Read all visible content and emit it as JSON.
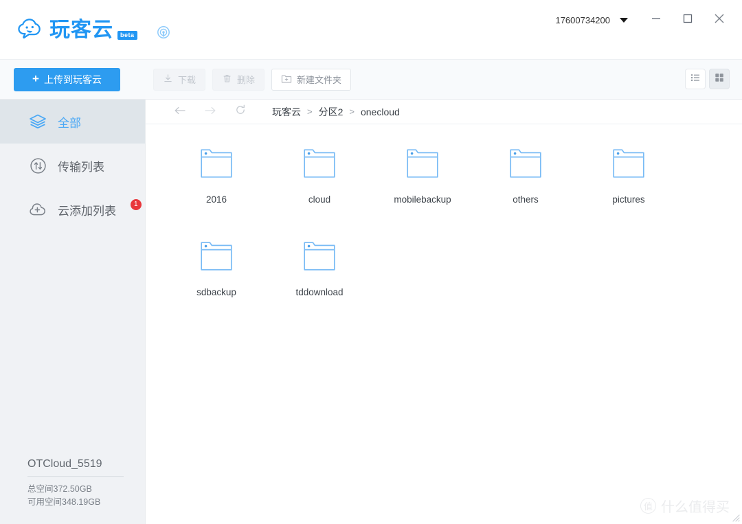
{
  "app": {
    "brand_name": "玩客云",
    "brand_tag": "beta",
    "logo_icon": "cloud-mascot-logo",
    "help_icon": "connection-signal-icon"
  },
  "titlebar": {
    "account_id": "17600734200",
    "account_caret_icon": "chevron-down-icon",
    "minimize_icon": "minimize-icon",
    "maximize_icon": "maximize-icon",
    "close_icon": "close-icon"
  },
  "toolbar": {
    "upload_label": "上传到玩客云",
    "upload_plus": "+",
    "download_label": "下载",
    "download_icon": "download-icon",
    "delete_label": "删除",
    "delete_icon": "trash-icon",
    "newfolder_label": "新建文件夹",
    "newfolder_icon": "folder-plus-icon",
    "list_view_icon": "list-view-icon",
    "grid_view_icon": "grid-view-icon",
    "active_view": "grid",
    "accent_color": "#2d9cf0"
  },
  "sidebar": {
    "items": [
      {
        "label": "全部",
        "icon": "layers-icon",
        "active": true,
        "badge": ""
      },
      {
        "label": "传输列表",
        "icon": "transfer-icon",
        "active": false,
        "badge": ""
      },
      {
        "label": "云添加列表",
        "icon": "cloud-plus-icon",
        "active": false,
        "badge": "1"
      }
    ],
    "storage": {
      "device_name": "OTCloud_5519",
      "total_label": "总空间372.50GB",
      "free_label": "可用空间348.19GB"
    }
  },
  "main": {
    "nav": {
      "back_icon": "arrow-left-icon",
      "forward_icon": "arrow-right-icon",
      "refresh_icon": "refresh-icon"
    },
    "breadcrumb": [
      "玩客云",
      "分区2",
      "onecloud"
    ],
    "breadcrumb_separator": ">",
    "files": [
      {
        "name": "2016",
        "type": "folder"
      },
      {
        "name": "cloud",
        "type": "folder"
      },
      {
        "name": "mobilebackup",
        "type": "folder"
      },
      {
        "name": "others",
        "type": "folder"
      },
      {
        "name": "pictures",
        "type": "folder"
      },
      {
        "name": "sdbackup",
        "type": "folder"
      },
      {
        "name": "tddownload",
        "type": "folder"
      }
    ]
  },
  "watermark": {
    "mark": "值",
    "text": "什么值得买"
  }
}
